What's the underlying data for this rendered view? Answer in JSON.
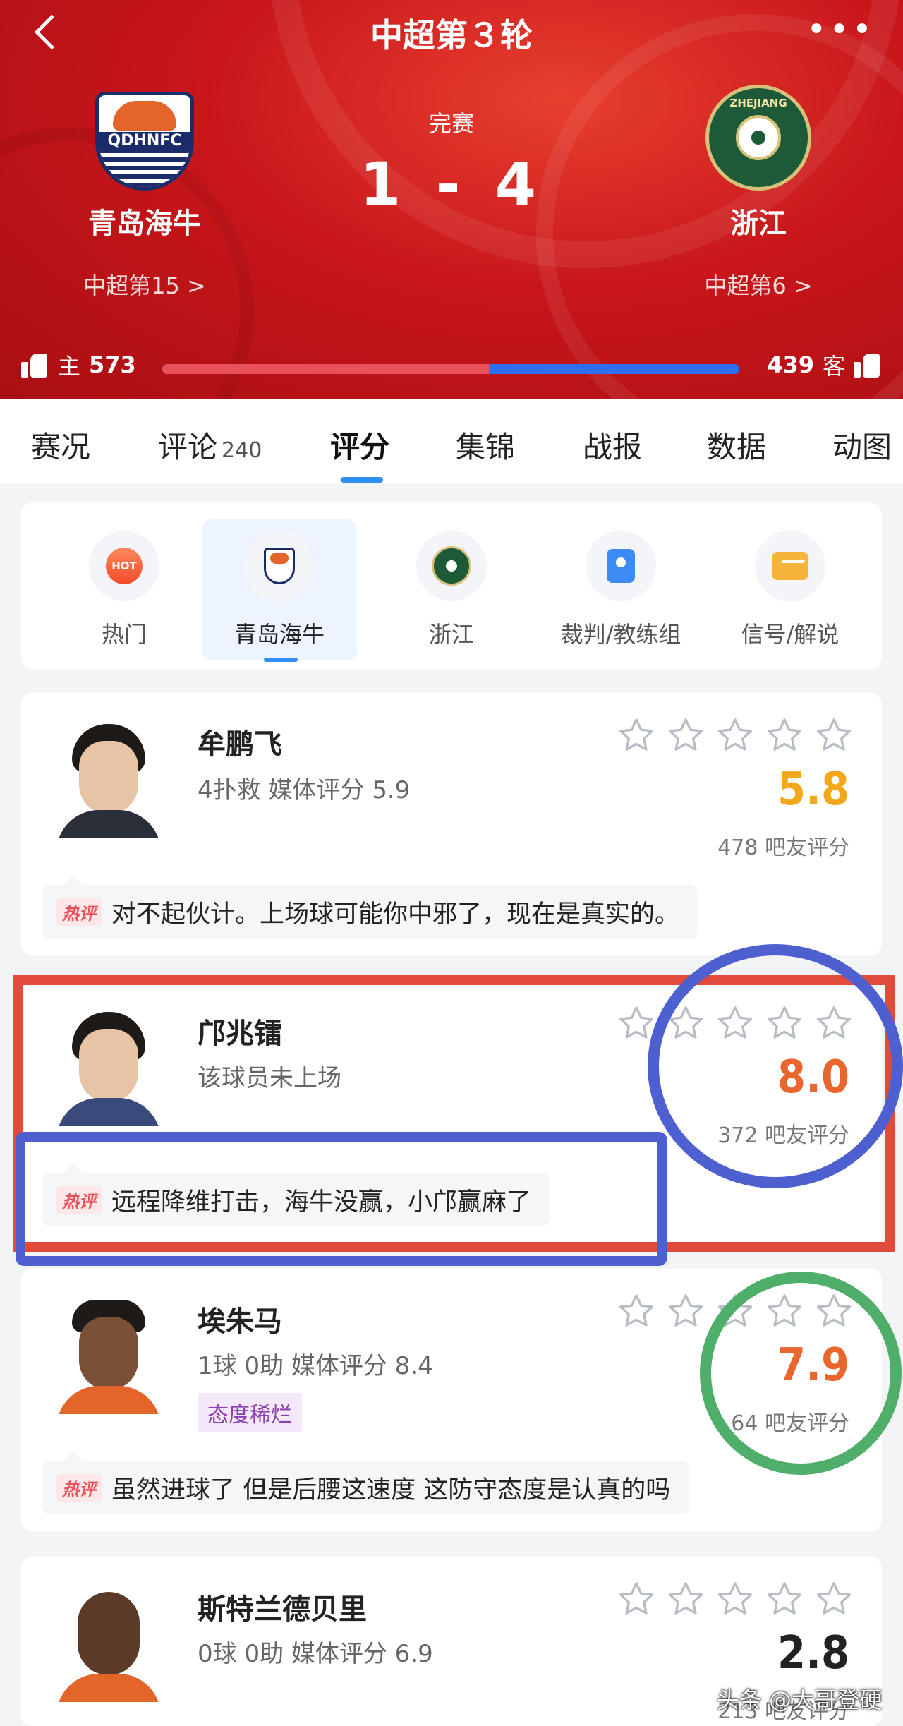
{
  "header": {
    "title": "中超第３轮",
    "status": "完赛",
    "score": "1 - 4",
    "home": {
      "name": "青岛海牛",
      "rank": "中超第15 >",
      "logo_text": "QDHNFC",
      "votes_label": "主",
      "votes": "573"
    },
    "away": {
      "name": "浙江",
      "rank": "中超第6 >",
      "logo_text": "ZHEJIANG",
      "votes_label": "客",
      "votes": "439"
    },
    "home_vote_share": 0.566
  },
  "tabs": [
    {
      "label": "赛况",
      "count": ""
    },
    {
      "label": "评论",
      "count": "240"
    },
    {
      "label": "评分",
      "count": ""
    },
    {
      "label": "集锦",
      "count": ""
    },
    {
      "label": "战报",
      "count": ""
    },
    {
      "label": "数据",
      "count": ""
    },
    {
      "label": "动图",
      "count": ""
    }
  ],
  "filters": [
    {
      "label": "热门",
      "icon": "hot-icon",
      "badge": "HOT"
    },
    {
      "label": "青岛海牛",
      "icon": "home-team-logo"
    },
    {
      "label": "浙江",
      "icon": "away-team-logo"
    },
    {
      "label": "裁判/教练组",
      "icon": "referee-icon"
    },
    {
      "label": "信号/解说",
      "icon": "signal-icon"
    }
  ],
  "hot_tag": "热评",
  "players": [
    {
      "name": "牟鹏飞",
      "stat": "4扑救  媒体评分 5.9",
      "rating": "5.8",
      "rating_color": "#f3a81c",
      "fans": "478 吧友评分",
      "comment": "对不起伙计。上场球可能你中邪了，现在是真实的。"
    },
    {
      "name": "邝兆镭",
      "stat": "该球员未上场",
      "rating": "8.0",
      "rating_color": "#e9662d",
      "fans": "372 吧友评分",
      "comment": "远程降维打击，海牛没赢，小邝赢麻了"
    },
    {
      "name": "埃朱马",
      "stat": "1球  0助  媒体评分 8.4",
      "tag": "态度稀烂",
      "rating": "7.9",
      "rating_color": "#e9662d",
      "fans": "64 吧友评分",
      "comment": "虽然进球了 但是后腰这速度 这防守态度是认真的吗"
    },
    {
      "name": "斯特兰德贝里",
      "stat": "0球  0助  媒体评分 6.9",
      "rating": "2.8",
      "rating_color": "#222222",
      "fans": "213 吧友评分"
    }
  ],
  "watermark": "头条 @大哥登硬"
}
